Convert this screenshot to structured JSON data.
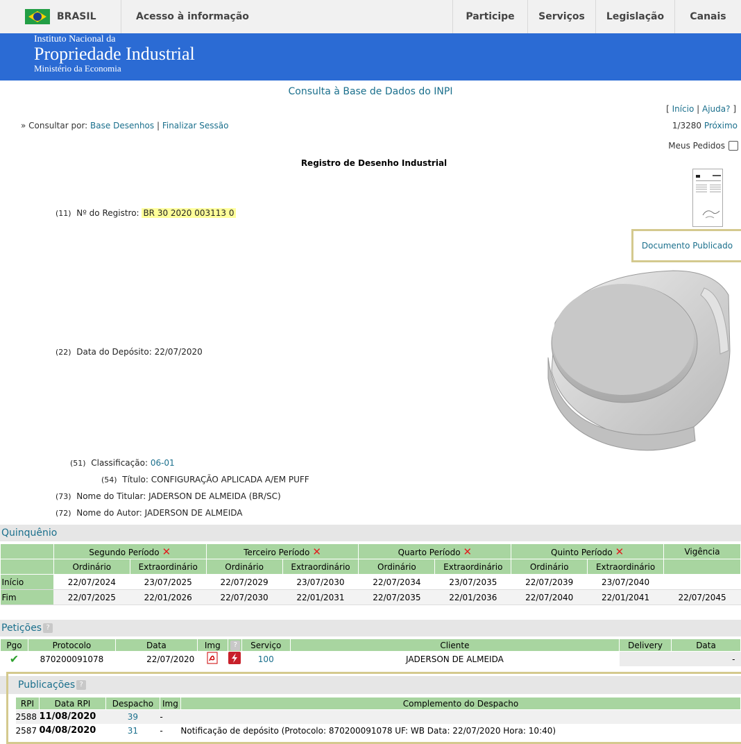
{
  "govbar": {
    "brasil": "BRASIL",
    "acesso": "Acesso à informação",
    "nav": [
      "Participe",
      "Serviços",
      "Legislação",
      "Canais"
    ]
  },
  "header": {
    "line1": "Instituto Nacional da",
    "line2": "Propriedade Industrial",
    "line3": "Ministério da Economia"
  },
  "page": {
    "title": "Consulta à Base de Dados do INPI",
    "inicio": "Início",
    "ajuda": "Ajuda?",
    "consultar_prefix": "» Consultar por:",
    "base_desenhos": "Base Desenhos",
    "finalizar": "Finalizar Sessão",
    "pager_count": "1/3280",
    "proximo": "Próximo",
    "meus_pedidos": "Meus Pedidos",
    "registro_title": "Registro de Desenho Industrial",
    "documento_publicado": "Documento Publicado"
  },
  "fields": {
    "registro_code": "(11)",
    "registro_label": "Nº do Registro:",
    "registro_value": "BR 30 2020 003113 0",
    "deposito_code": "(22)",
    "deposito_label": "Data do Depósito:",
    "deposito_value": "22/07/2020",
    "classif_code": "(51)",
    "classif_label": "Classificação:",
    "classif_value": "06-01",
    "titulo_code": "(54)",
    "titulo_label": "Título:",
    "titulo_value": "CONFIGURAÇÃO APLICADA A/EM PUFF",
    "titular_code": "(73)",
    "titular_label": "Nome do Titular:",
    "titular_value": "JADERSON DE ALMEIDA (BR/SC)",
    "autor_code": "(72)",
    "autor_label": "Nome do Autor:",
    "autor_value": "JADERSON DE ALMEIDA"
  },
  "quinquenio": {
    "heading": "Quinquênio",
    "periods": [
      "Segundo Período",
      "Terceiro Período",
      "Quarto Período",
      "Quinto Período"
    ],
    "vigencia": "Vigência",
    "ordinario": "Ordinário",
    "extraordinario": "Extraordinário",
    "inicio_label": "Início",
    "fim_label": "Fim",
    "inicio": [
      "22/07/2024",
      "23/07/2025",
      "22/07/2029",
      "23/07/2030",
      "22/07/2034",
      "23/07/2035",
      "22/07/2039",
      "23/07/2040",
      ""
    ],
    "fim": [
      "22/07/2025",
      "22/01/2026",
      "22/07/2030",
      "22/01/2031",
      "22/07/2035",
      "22/01/2036",
      "22/07/2040",
      "22/01/2041",
      "22/07/2045"
    ]
  },
  "peticoes": {
    "heading": "Petições",
    "cols": [
      "Pgo",
      "Protocolo",
      "Data",
      "Img",
      "Serviço",
      "Cliente",
      "Delivery",
      "Data"
    ],
    "row": {
      "protocolo": "870200091078",
      "data": "22/07/2020",
      "servico": "100",
      "cliente": "JADERSON DE ALMEIDA",
      "delivery": "",
      "data2": "-"
    }
  },
  "publicacoes": {
    "heading": "Publicações",
    "cols": [
      "RPI",
      "Data RPI",
      "Despacho",
      "Img",
      "Complemento do Despacho"
    ],
    "rows": [
      {
        "rpi": "2588",
        "data": "11/08/2020",
        "despacho": "39",
        "img": "-",
        "complemento": ""
      },
      {
        "rpi": "2587",
        "data": "04/08/2020",
        "despacho": "31",
        "img": "-",
        "complemento": "Notificação de depósito (Protocolo: 870200091078 UF: WB Data: 22/07/2020 Hora: 10:40)"
      }
    ]
  }
}
